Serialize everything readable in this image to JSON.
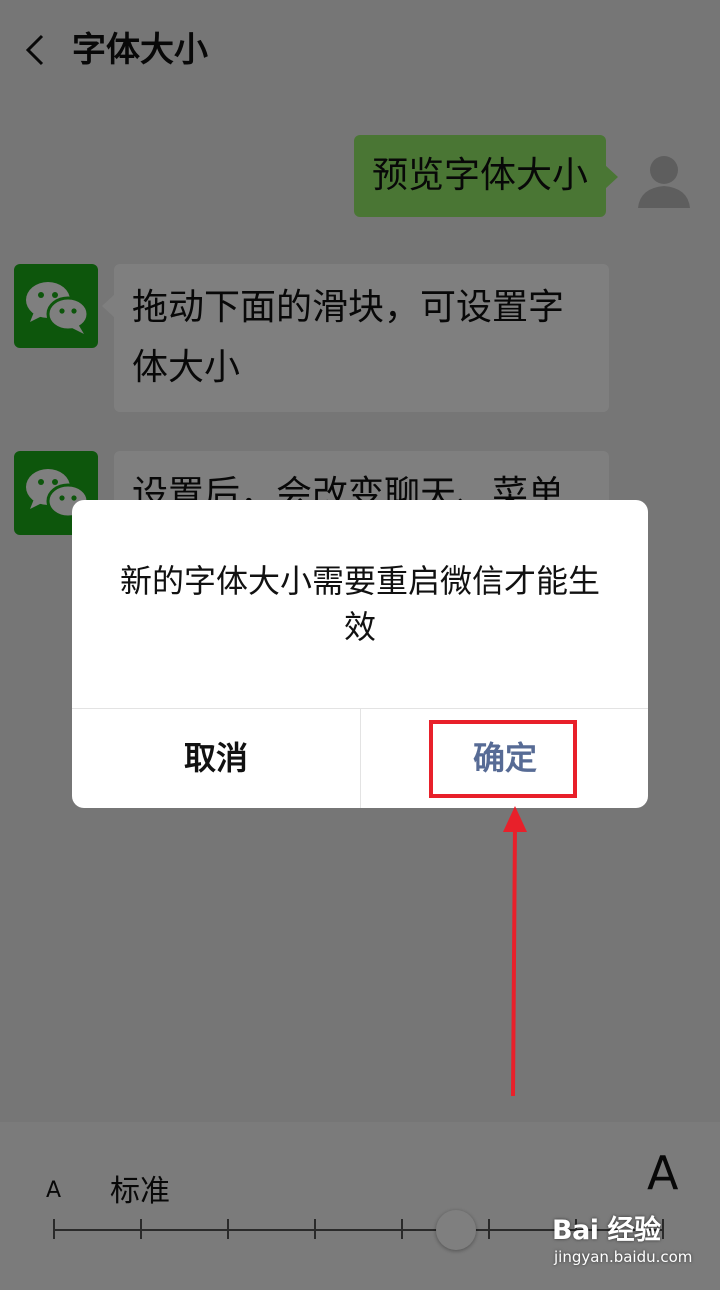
{
  "header": {
    "title": "字体大小"
  },
  "chat": {
    "preview_message": "预览字体大小",
    "tip_message": "拖动下面的滑块，可设置字体大小",
    "tip_message_2": "设置后，会改变聊天、菜单"
  },
  "font_panel": {
    "small_a": "A",
    "standard_label": "标准",
    "large_a": "A",
    "tick_count": 8,
    "selected_step": 4
  },
  "dialog": {
    "message": "新的字体大小需要重启微信才能生效",
    "cancel_label": "取消",
    "confirm_label": "确定"
  },
  "watermark": {
    "brand": "Bai 经验",
    "url": "jingyan.baidu.com"
  },
  "colors": {
    "bubble_green": "#95ec69",
    "wechat_green": "#1aad19",
    "confirm_blue": "#576b95",
    "annotation_red": "#e8202a"
  }
}
